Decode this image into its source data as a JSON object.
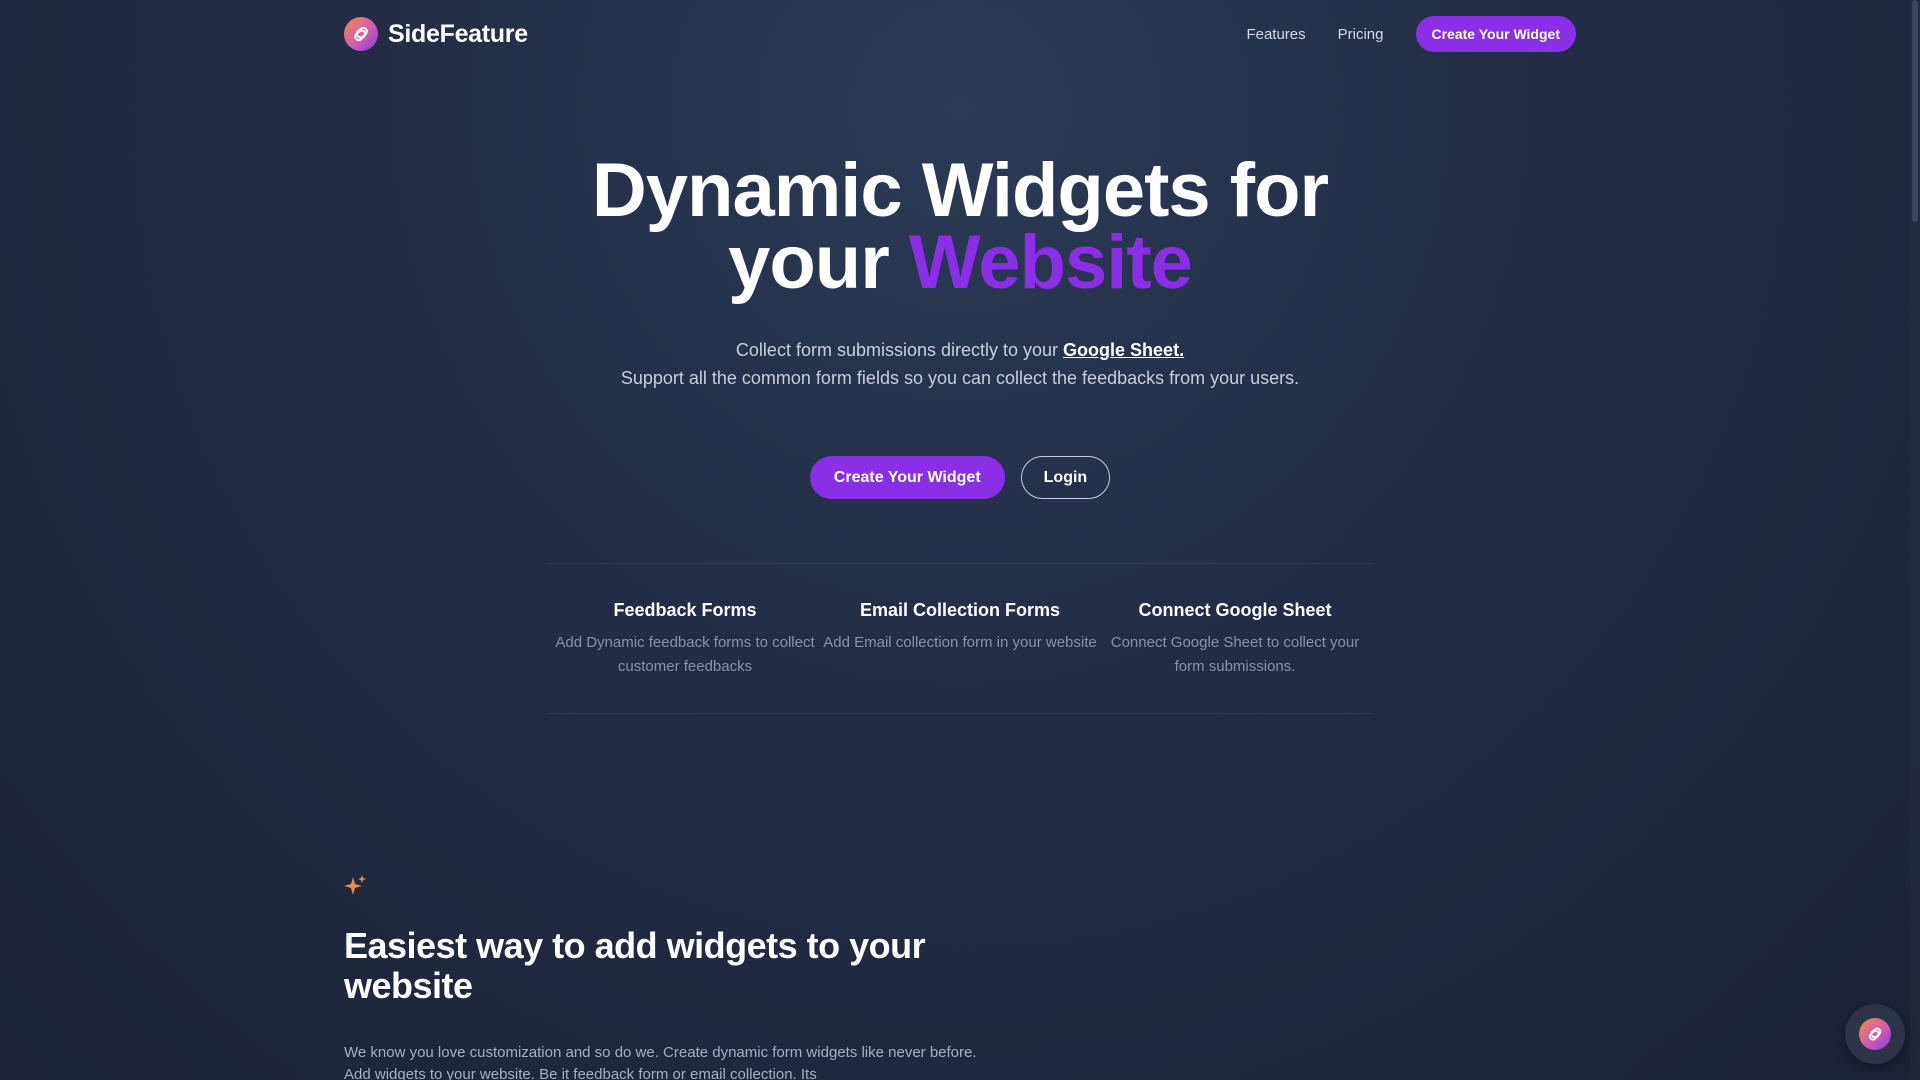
{
  "header": {
    "brand_name": "SideFeature",
    "logo_icon": "sidefeature-logo-icon",
    "nav": [
      {
        "label": "Features"
      },
      {
        "label": "Pricing"
      }
    ],
    "cta_label": "Create Your Widget"
  },
  "hero": {
    "title_line1": "Dynamic Widgets for",
    "title_line2_prefix": "your",
    "title_line2_accent": "Website",
    "sub_line1_prefix": "Collect form submissions directly to your",
    "sub_line1_link": "Google Sheet.",
    "sub_line2": "Support all the common form fields so you can collect the feedbacks from your users.",
    "primary_button": "Create Your Widget",
    "secondary_button": "Login"
  },
  "features": [
    {
      "title": "Feedback Forms",
      "description": "Add Dynamic feedback forms to collect customer feedbacks"
    },
    {
      "title": "Email Collection Forms",
      "description": "Add Email collection form in your website"
    },
    {
      "title": "Connect Google Sheet",
      "description": "Connect Google Sheet to collect your form submissions."
    }
  ],
  "section": {
    "icon": "sparkle-icon",
    "title": "Easiest way to add widgets to your website",
    "body": "We know you love customization and so do we. Create dynamic form widgets like never before. Add widgets to your website. Be it feedback form or email collection. Its"
  },
  "colors": {
    "accent": "#8b2fe6",
    "background": "#222c44",
    "sparkle": "#f08a4b"
  }
}
